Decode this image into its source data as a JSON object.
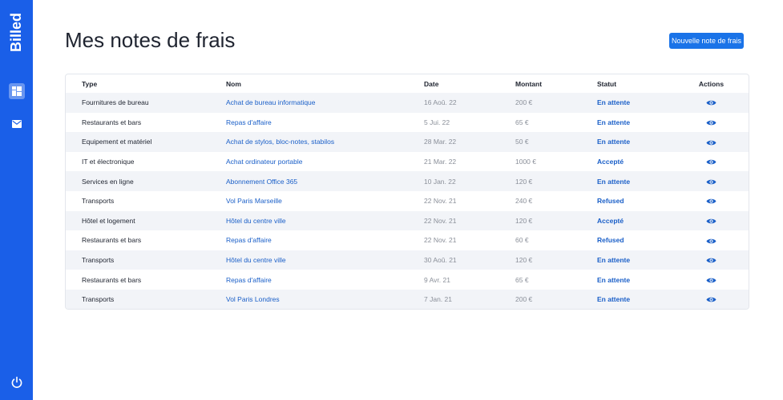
{
  "sidebar": {
    "brand": "Billed",
    "items": [
      {
        "icon": "window-icon",
        "active": true
      },
      {
        "icon": "mail-icon",
        "active": false
      }
    ],
    "logout_icon": "power-icon"
  },
  "header": {
    "title": "Mes notes de frais",
    "new_button": "Nouvelle note de frais"
  },
  "table": {
    "columns": [
      "Type",
      "Nom",
      "Date",
      "Montant",
      "Statut",
      "Actions"
    ],
    "rows": [
      {
        "type": "Fournitures de bureau",
        "name": "Achat de bureau informatique",
        "date": "16 Aoû. 22",
        "amount": "200 €",
        "status": "En attente"
      },
      {
        "type": "Restaurants et bars",
        "name": "Repas d'affaire",
        "date": "5 Jui. 22",
        "amount": "65 €",
        "status": "En attente"
      },
      {
        "type": "Equipement et matériel",
        "name": "Achat de stylos, bloc-notes, stabilos",
        "date": "28 Mar. 22",
        "amount": "50 €",
        "status": "En attente"
      },
      {
        "type": "IT et électronique",
        "name": "Achat ordinateur portable",
        "date": "21 Mar. 22",
        "amount": "1000 €",
        "status": "Accepté"
      },
      {
        "type": "Services en ligne",
        "name": "Abonnement Office 365",
        "date": "10 Jan. 22",
        "amount": "120 €",
        "status": "En attente"
      },
      {
        "type": "Transports",
        "name": "Vol Paris Marseille",
        "date": "22 Nov. 21",
        "amount": "240 €",
        "status": "Refused"
      },
      {
        "type": "Hôtel et logement",
        "name": "Hôtel du centre ville",
        "date": "22 Nov. 21",
        "amount": "120 €",
        "status": "Accepté"
      },
      {
        "type": "Restaurants et bars",
        "name": "Repas d'affaire",
        "date": "22 Nov. 21",
        "amount": "60 €",
        "status": "Refused"
      },
      {
        "type": "Transports",
        "name": "Hôtel du centre ville",
        "date": "30 Aoû. 21",
        "amount": "120 €",
        "status": "En attente"
      },
      {
        "type": "Restaurants et bars",
        "name": "Repas d'affaire",
        "date": "9 Avr. 21",
        "amount": "65 €",
        "status": "En attente"
      },
      {
        "type": "Transports",
        "name": "Vol Paris Londres",
        "date": "7 Jan. 21",
        "amount": "200 €",
        "status": "En attente"
      }
    ],
    "action_icon": "eye-icon"
  },
  "colors": {
    "sidebar": "#1a5fe8",
    "accent": "#1a73e8",
    "link": "#1a5fc8",
    "row_stripe": "#f2f4f8"
  }
}
